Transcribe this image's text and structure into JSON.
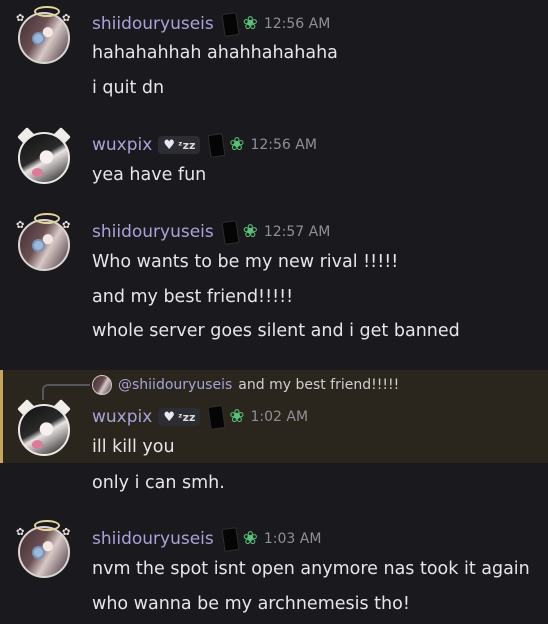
{
  "messages": [
    {
      "author": "shiidouryuseis",
      "time": "12:56 AM",
      "lines": [
        "hahahahhah ahahhahahaha",
        "i quit dn"
      ]
    },
    {
      "author": "wuxpix",
      "tag": "ᶻz𝘇",
      "time": "12:56 AM",
      "lines": [
        "yea have fun"
      ]
    },
    {
      "author": "shiidouryuseis",
      "time": "12:57 AM",
      "lines": [
        "Who wants to be my new rival !!!!!",
        "and my best friend!!!!!",
        "whole server goes silent and i get banned"
      ]
    },
    {
      "author": "wuxpix",
      "tag": "ᶻz𝘇",
      "time": "1:02 AM",
      "reply": {
        "author": "@shiidouryuseis",
        "text": "and my best friend!!!!!"
      },
      "lines": [
        "ill kill you",
        "only i can smh."
      ]
    },
    {
      "author": "shiidouryuseis",
      "time": "1:03 AM",
      "lines": [
        "nvm the spot isnt open anymore nas took it again",
        "who wanna be my archnemesis tho!"
      ]
    }
  ],
  "icons": {
    "tag_heart": "♥",
    "leaf": "❀"
  },
  "colors": {
    "background": "#1a1a1e",
    "username": "#a8a3d8",
    "timestamp": "#8f8f96",
    "text": "#e6e6e8",
    "reply_highlight": "#2b261d",
    "reply_bar": "#c9a64f",
    "leaf_badge": "#57c27a"
  }
}
